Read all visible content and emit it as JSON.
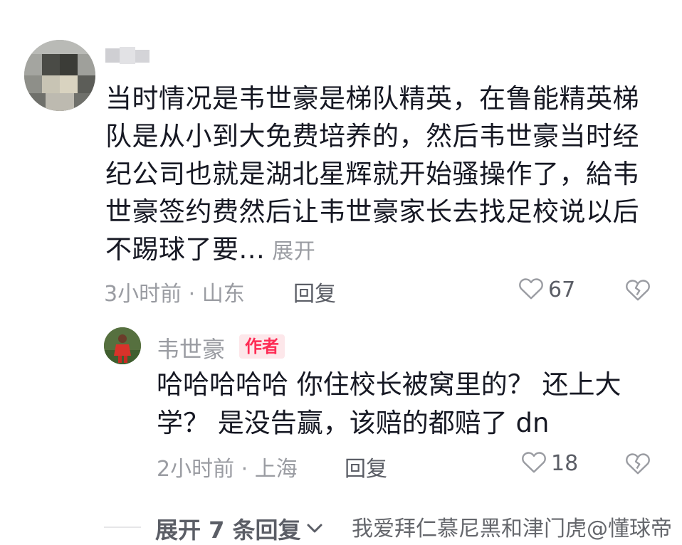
{
  "comment": {
    "text": "当时情况是韦世豪是梯队精英，在鲁能精英梯队是从小到大免费培养的，然后韦世豪当时经纪公司也就是湖北星辉就开始骚操作了，給韦世豪签约费然后让韦世豪家长去找足校说以后不踢球了要...",
    "expand_label": "展开",
    "time_location": "3小时前 · 山东",
    "reply_label": "回复",
    "likes": "67"
  },
  "reply": {
    "username": "韦世豪",
    "badge": "作者",
    "text": "哈哈哈哈哈 你住校长被窝里的？ 还上大学？ 是没告赢，该赔的都赔了 dn",
    "time_location": "2小时前 · 上海",
    "reply_label": "回复",
    "likes": "18"
  },
  "footer": {
    "expand_replies_label": "展开 7 条回复",
    "watermark": "我爱拜仁慕尼黑和津门虎@懂球帝"
  },
  "icons": {
    "like": "heart-outline-icon",
    "dislike": "broken-heart-icon",
    "chevron": "chevron-down-icon"
  },
  "colors": {
    "text": "#161823",
    "secondary": "#9a9ca2",
    "action": "#5b5e66",
    "badge_bg": "#fde7ea",
    "badge_text": "#fe2c55"
  }
}
